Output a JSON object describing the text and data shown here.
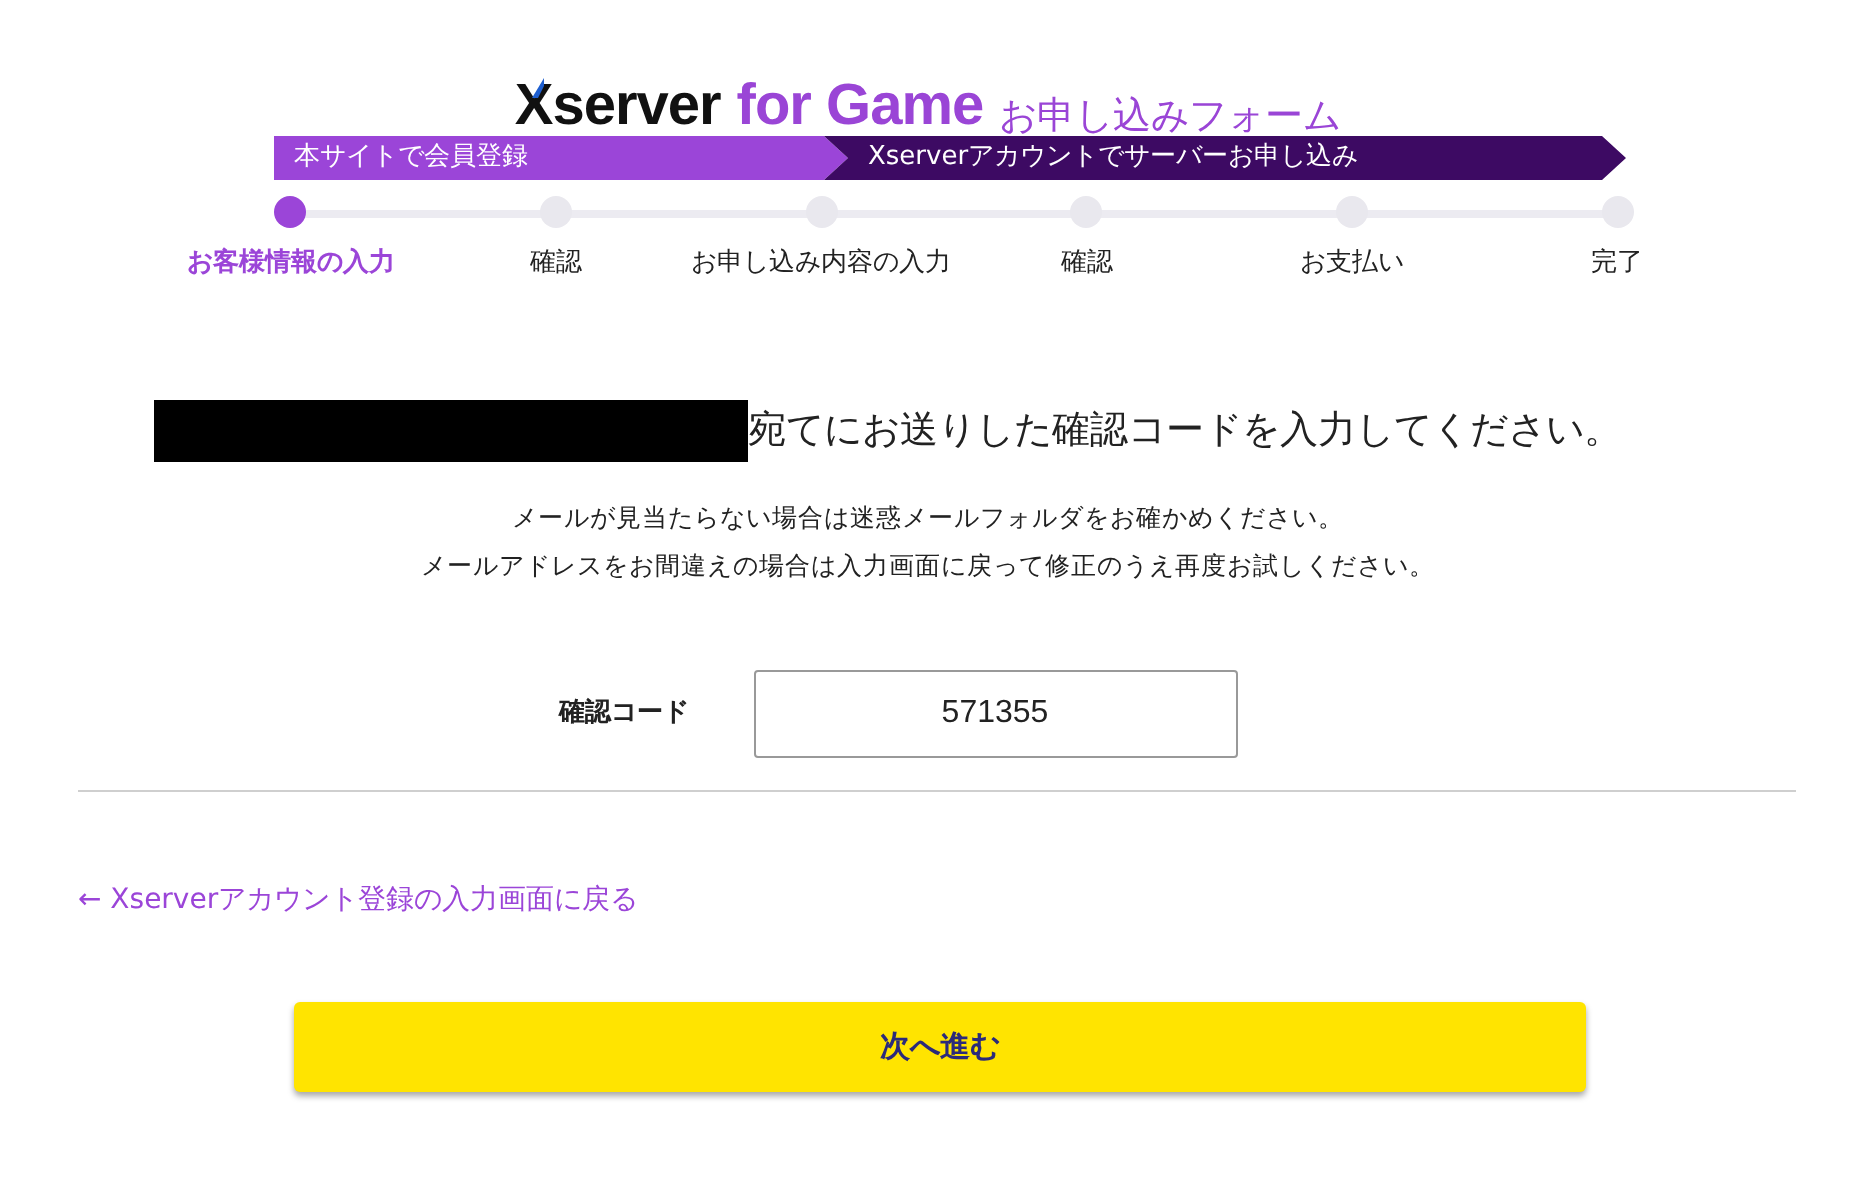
{
  "header": {
    "brand": "Xserver",
    "product": "for Game",
    "form_title": "お申し込みフォーム"
  },
  "phases": [
    {
      "label": "本サイトで会員登録",
      "kind": "light"
    },
    {
      "label": "Xserverアカウントでサーバーお申し込み",
      "kind": "dark"
    }
  ],
  "steps": [
    {
      "label": "お客様情報の入力",
      "selected": true
    },
    {
      "label": "確認",
      "selected": false
    },
    {
      "label": "お申し込み内容の入力",
      "selected": false
    },
    {
      "label": "確認",
      "selected": false
    },
    {
      "label": "お支払い",
      "selected": false
    },
    {
      "label": "完了",
      "selected": false
    }
  ],
  "heading": "宛てにお送りした確認コードを入力してください。",
  "notes": [
    "メールが見当たらない場合は迷惑メールフォルダをお確かめください。",
    "メールアドレスをお間違えの場合は入力画面に戻って修正のうえ再度お試しください。"
  ],
  "code_field": {
    "label": "確認コード",
    "value": "571355"
  },
  "back_link": "← Xserverアカウント登録の入力画面に戻る",
  "next_button": "次へ進む"
}
